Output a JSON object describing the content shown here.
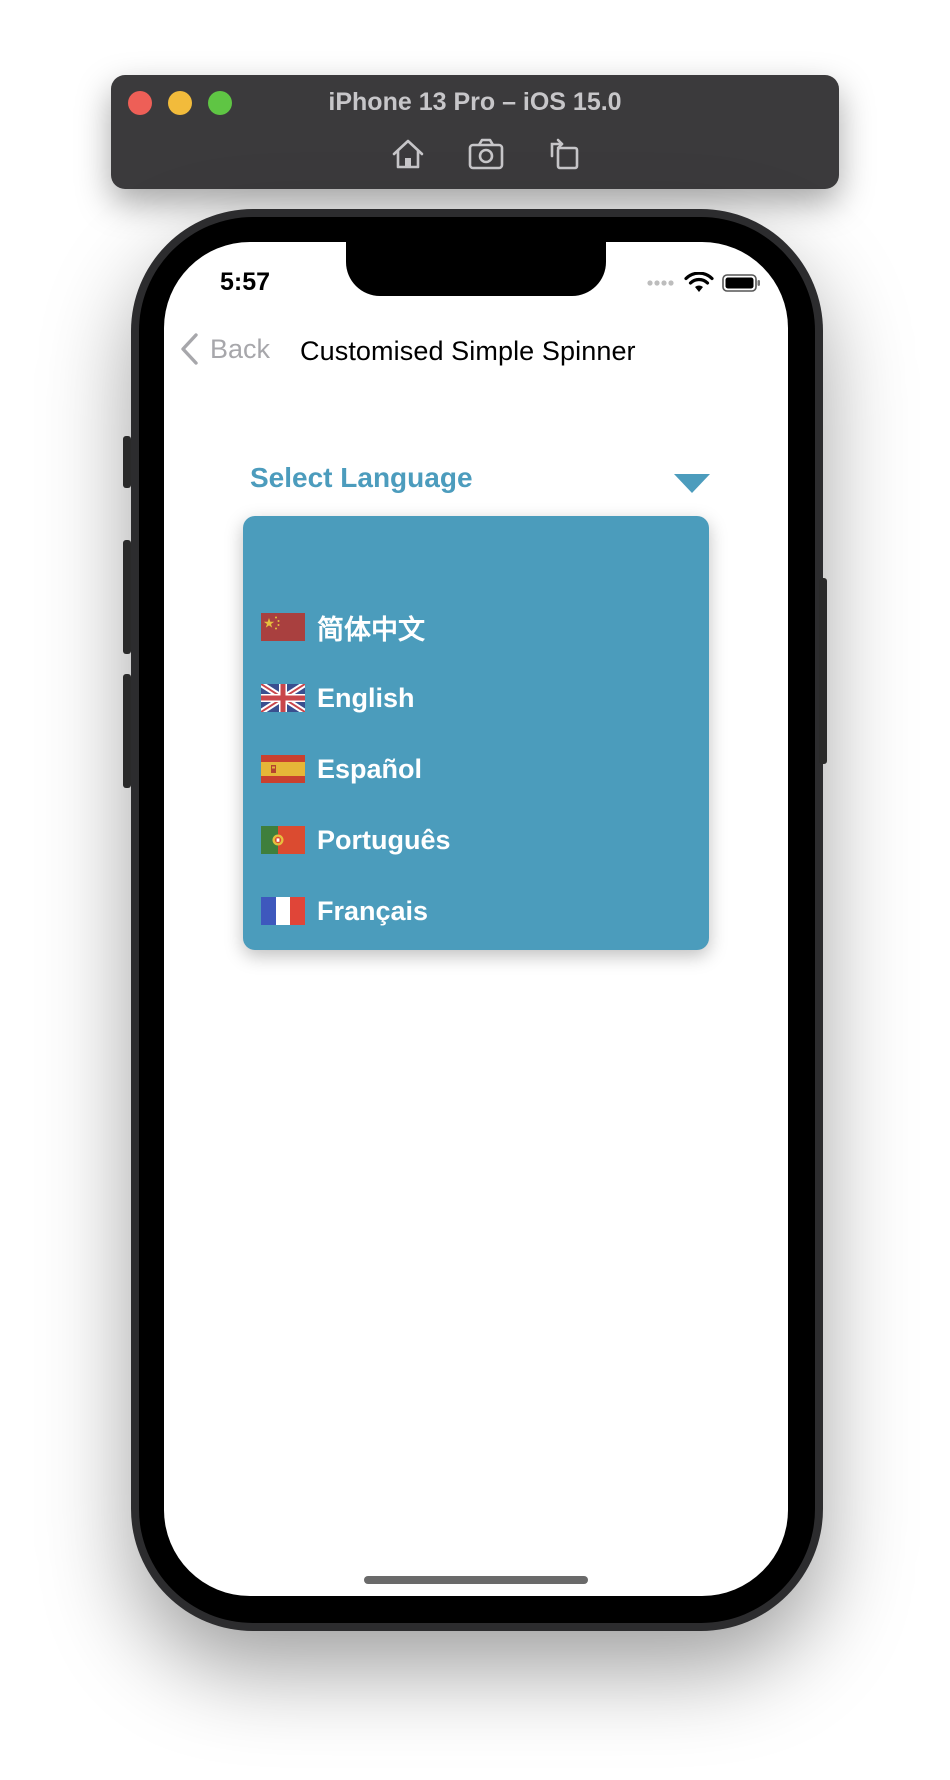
{
  "simulator": {
    "title": "iPhone 13 Pro – iOS 15.0",
    "tools": [
      "home-icon",
      "screenshot-icon",
      "rotate-icon"
    ]
  },
  "status_bar": {
    "time": "5:57",
    "icons": [
      "signal-icon",
      "wifi-icon",
      "battery-icon"
    ]
  },
  "nav": {
    "back_label": "Back",
    "title": "Customised Simple Spinner"
  },
  "spinner": {
    "label": "Select Language",
    "accent_color": "#4c9cbd",
    "dropdown_color": "#4b9cbc",
    "options": [
      {
        "flag": "china-flag-icon",
        "label": "简体中文"
      },
      {
        "flag": "uk-flag-icon",
        "label": "English"
      },
      {
        "flag": "spain-flag-icon",
        "label": "Español"
      },
      {
        "flag": "portugal-flag-icon",
        "label": "Português"
      },
      {
        "flag": "france-flag-icon",
        "label": "Français"
      }
    ]
  }
}
